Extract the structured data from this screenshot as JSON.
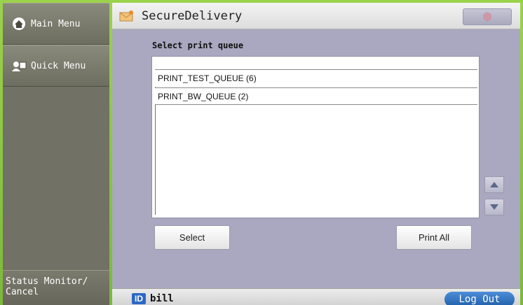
{
  "sidebar": {
    "main_menu": "Main Menu",
    "quick_menu": "Quick Menu",
    "status_monitor": "Status Monitor/\nCancel"
  },
  "header": {
    "title": "SecureDelivery"
  },
  "main": {
    "section_label": "Select print queue",
    "queues": [
      {
        "label": "PRINT_TEST_QUEUE (6)"
      },
      {
        "label": "PRINT_BW_QUEUE (2)"
      }
    ],
    "select_label": "Select",
    "print_all_label": "Print All"
  },
  "footer": {
    "id_badge": "ID",
    "user": "bill",
    "logout_label": "Log Out"
  },
  "colors": {
    "frame_green": "#8cc63f",
    "sidebar_gray": "#6e6e62",
    "panel_lavender": "#a9a8c0",
    "logout_blue": "#2f72c0"
  }
}
